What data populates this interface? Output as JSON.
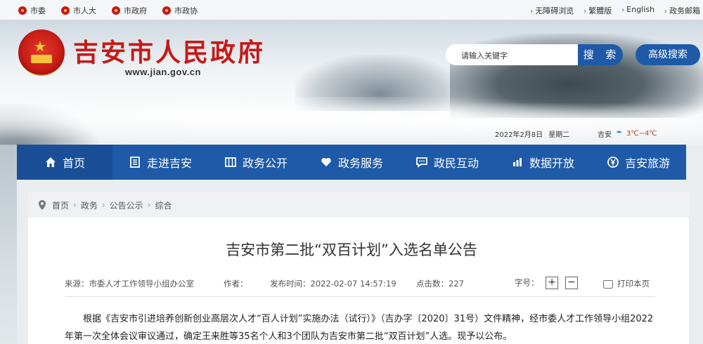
{
  "topbar": {
    "links": [
      {
        "label": "市委",
        "icon": "party-emblem-icon"
      },
      {
        "label": "市人大",
        "icon": "npc-emblem-icon"
      },
      {
        "label": "市政府",
        "icon": "gov-emblem-icon"
      },
      {
        "label": "市政协",
        "icon": "cppcc-emblem-icon"
      }
    ],
    "tools": [
      "无障碍浏览",
      "繁體版",
      "English",
      "政务邮箱"
    ]
  },
  "header": {
    "site_title": "吉安市人民政府",
    "site_url": "www.jian.gov.cn",
    "search_placeholder": "请输入关键字",
    "search_button": "搜 索",
    "advanced_search": "高级搜索"
  },
  "status": {
    "date": "2022年2月8日",
    "weekday": "星期二",
    "city": "吉安",
    "temperature": "3℃~4℃"
  },
  "nav": {
    "items": [
      {
        "label": "首页",
        "icon": "home-icon"
      },
      {
        "label": "走进吉安",
        "icon": "book-icon"
      },
      {
        "label": "政务公开",
        "icon": "columns-icon"
      },
      {
        "label": "政务服务",
        "icon": "heart-hands-icon"
      },
      {
        "label": "政民互动",
        "icon": "chat-icon"
      },
      {
        "label": "数据开放",
        "icon": "bar-chart-icon"
      },
      {
        "label": "吉安旅游",
        "icon": "yuan-icon"
      }
    ]
  },
  "breadcrumb": [
    "首页",
    "政务",
    "公告公示",
    "综合"
  ],
  "article": {
    "title": "吉安市第二批“双百计划”入选名单公告",
    "source": "来源：市委人才工作领导小组办公室",
    "author": "作者：",
    "publish_time": "发布时间：2022-02-07 14:57:19",
    "clicks": "点击数：227",
    "font_size_label": "字号：",
    "font_increase": "+",
    "font_decrease": "−",
    "print": "打印本页",
    "paragraph": "根据《吉安市引进培养创新创业高层次人才“百人计划”实施办法（试行）》（吉办字〔2020〕31号）文件精神，经市委人才工作领导小组2022年第一次全体会议审议通过，确定王来胜等35名个人和3个团队为吉安市第二批“双百计划”人选。现予以公布。"
  }
}
